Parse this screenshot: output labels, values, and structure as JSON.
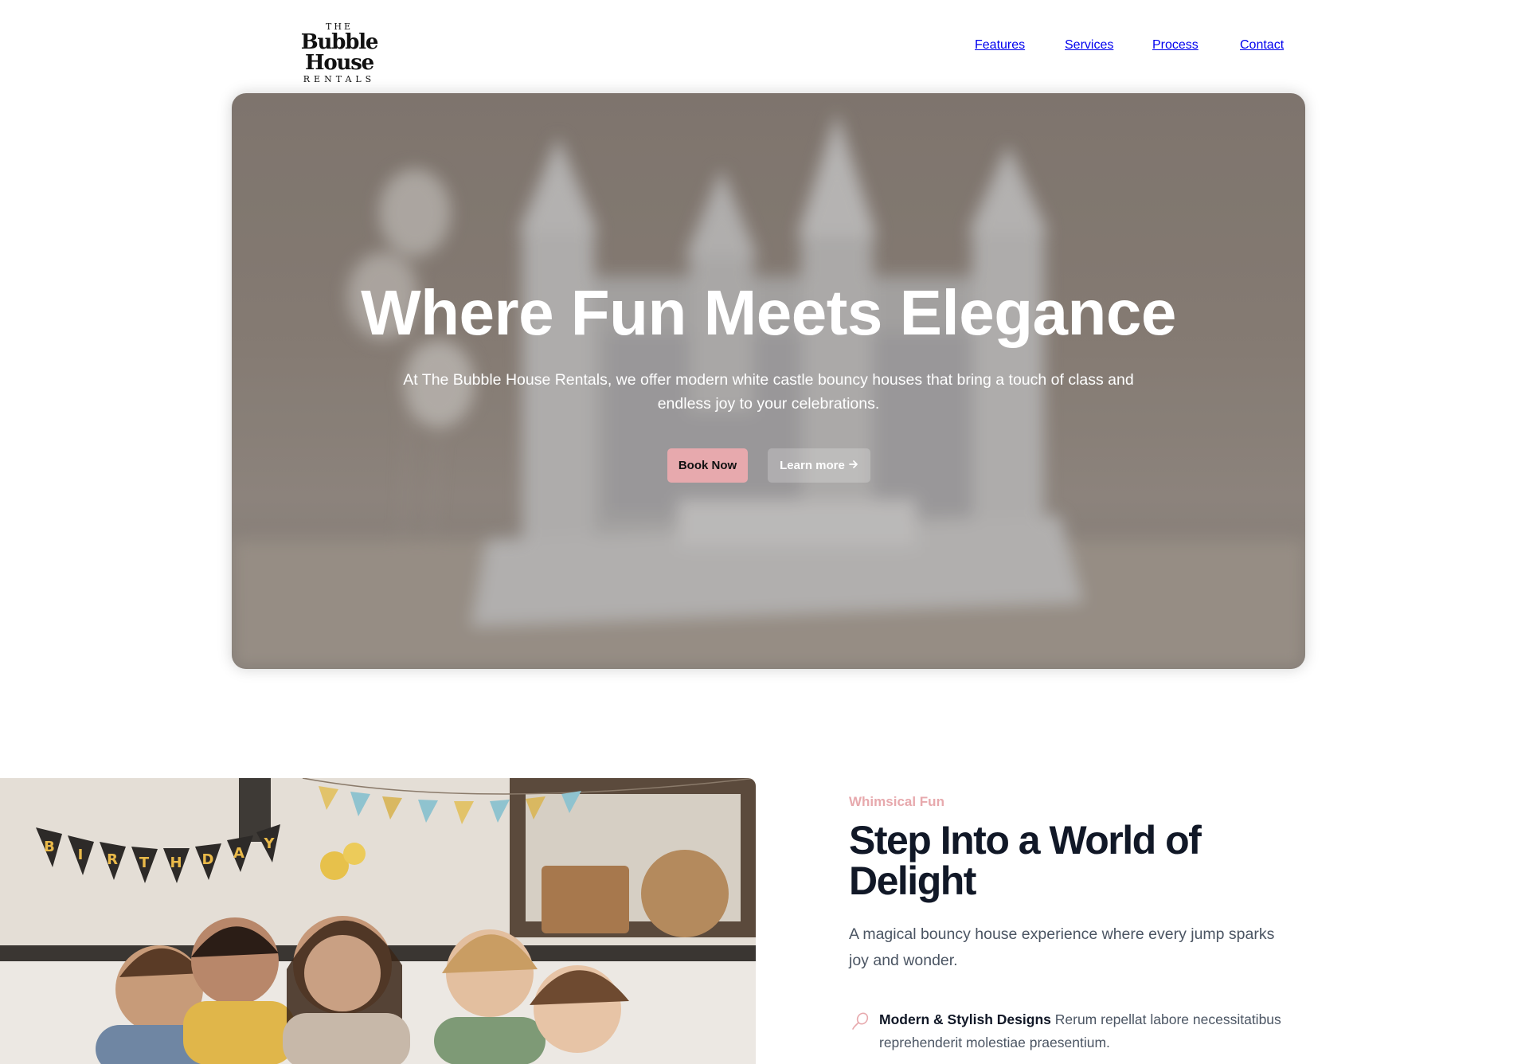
{
  "header": {
    "logo": {
      "the": "THE",
      "main": "Bubble House",
      "rentals": "RENTALS"
    },
    "nav": [
      {
        "label": "Features"
      },
      {
        "label": "Services"
      },
      {
        "label": "Process"
      },
      {
        "label": "Contact"
      }
    ]
  },
  "hero": {
    "title": "Where Fun Meets Elegance",
    "subtitle": "At The Bubble House Rentals, we offer modern white castle bouncy houses that bring a touch of class and endless joy to your celebrations.",
    "primary_button": "Book Now",
    "secondary_button": "Learn more",
    "secondary_icon": "arrow-right-icon"
  },
  "section": {
    "eyebrow": "Whimsical Fun",
    "title": "Step Into a World of Delight",
    "subtitle": "A magical bouncy house experience where every jump sparks joy and wonder.",
    "features": [
      {
        "icon": "balloon-icon",
        "title": "Modern & Stylish Designs",
        "text": "Rerum repellat labore necessitatibus reprehenderit molestiae praesentium."
      }
    ]
  },
  "banner": {
    "letters": [
      "B",
      "I",
      "R",
      "T",
      "H",
      "D",
      "A",
      "Y"
    ]
  },
  "colors": {
    "accent": "#e7a9ad",
    "heading": "#111827",
    "body": "#4b5563"
  }
}
